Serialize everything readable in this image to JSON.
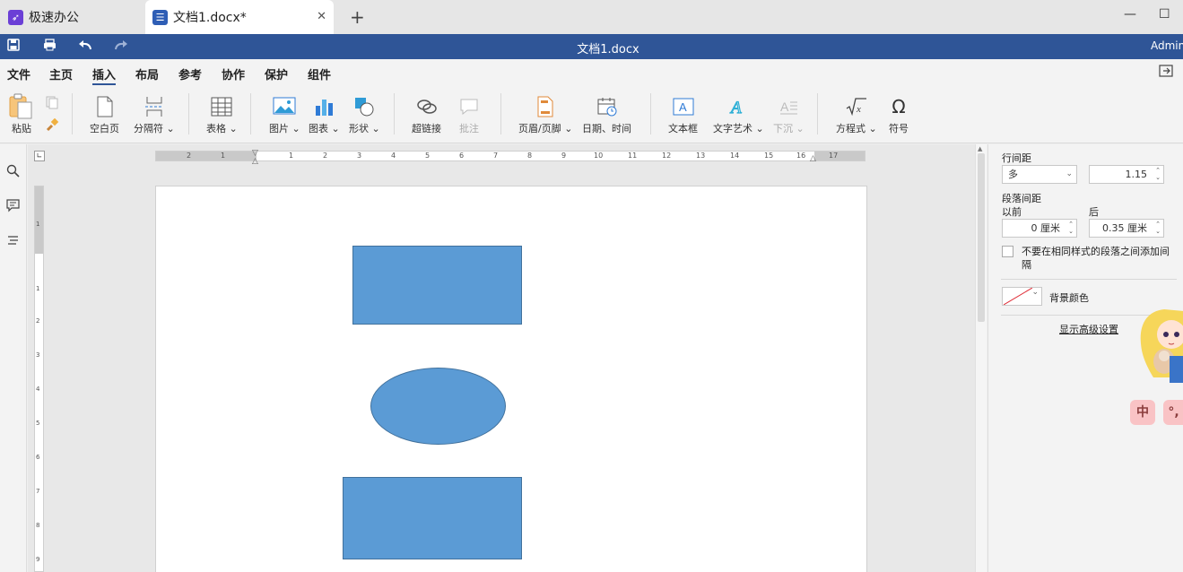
{
  "tabs": {
    "home_label": "极速办公",
    "doc_label": "文档1.docx*",
    "close_glyph": "✕",
    "new_glyph": "+"
  },
  "window": {
    "min_glyph": "—",
    "max_glyph": "☐"
  },
  "titlebar": {
    "title": "文档1.docx",
    "user": "Adminis"
  },
  "menu": {
    "items": [
      "文件",
      "主页",
      "插入",
      "布局",
      "参考",
      "协作",
      "保护",
      "组件"
    ],
    "active": "插入"
  },
  "toolbar": {
    "paste": "粘贴",
    "blank_page": "空白页",
    "separator": "分隔符",
    "table": "表格",
    "image": "图片",
    "chart": "图表",
    "shape": "形状",
    "hyperlink": "超链接",
    "comment": "批注",
    "header_footer": "页眉/页脚",
    "datetime": "日期、时间",
    "textbox": "文本框",
    "textart": "文字艺术",
    "dropcap": "下沉",
    "equation": "方程式",
    "symbol": "符号"
  },
  "ruler": {
    "h_numbers": [
      "2",
      "1",
      "1",
      "2",
      "3",
      "4",
      "5",
      "6",
      "7",
      "8",
      "9",
      "10",
      "11",
      "12",
      "13",
      "14",
      "15",
      "16",
      "17"
    ],
    "v_numbers": [
      "1",
      "1",
      "2",
      "3",
      "4",
      "5",
      "6",
      "7",
      "8",
      "9"
    ]
  },
  "right_panel": {
    "line_spacing_label": "行间距",
    "line_spacing_mode": "多",
    "line_spacing_value": "1.15",
    "para_spacing_label": "段落间距",
    "before_label": "以前",
    "after_label": "后",
    "before_value": "0 厘米",
    "after_value": "0.35 厘米",
    "no_space_same_style": "不要在相同样式的段落之间添加间隔",
    "bg_color_label": "背景颜色",
    "advanced_link": "显示高级设置"
  },
  "ime": {
    "zh": "中",
    "punct": "°,"
  },
  "colors": {
    "accent": "#2f5597",
    "shape_fill": "#5b9bd5",
    "shape_border": "#41719c"
  }
}
